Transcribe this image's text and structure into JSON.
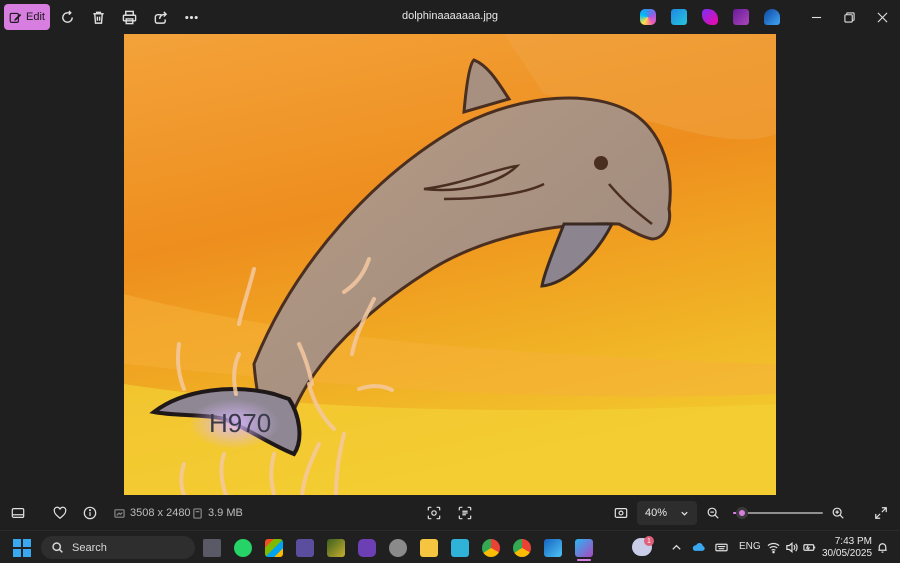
{
  "toolbar": {
    "edit_label": "Edit",
    "icons": [
      "rotate-icon",
      "delete-icon",
      "print-icon",
      "share-icon",
      "more-icon"
    ]
  },
  "window": {
    "title": "dolphinaaaaaaa.jpg"
  },
  "image": {
    "text": "H970"
  },
  "statusbar": {
    "dimensions": "3508 x 2480",
    "file_size": "3.9 MB",
    "zoom": "40%",
    "zoom_level": 0.1
  },
  "taskbar": {
    "search_placeholder": "Search",
    "language": "ENG",
    "time": "7:43 PM",
    "date": "30/05/2025",
    "weather_badge": "1"
  },
  "colors": {
    "accent": "#d77ee0",
    "background": "#1f1f1f"
  }
}
